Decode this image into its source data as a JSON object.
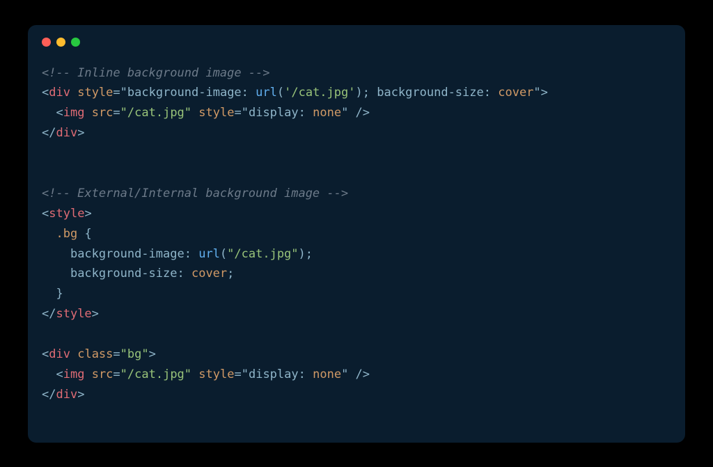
{
  "code": {
    "l1": {
      "comment": "<!-- Inline background image -->"
    },
    "l2": {
      "open": "<",
      "tag": "div",
      "sp": " ",
      "attr": "style",
      "eq": "=",
      "q1": "\"",
      "prop1": "background-image",
      "col1": ": ",
      "func": "url",
      "paren1": "(",
      "url1": "'/cat.jpg'",
      "paren2": ")",
      "semi1": "; ",
      "prop2": "background-size",
      "col2": ": ",
      "val2": "cover",
      "q2": "\"",
      "close": ">"
    },
    "l3": {
      "indent": "  ",
      "open": "<",
      "tag": "img",
      "sp1": " ",
      "attr1": "src",
      "eq1": "=",
      "val1": "\"/cat.jpg\"",
      "sp2": " ",
      "attr2": "style",
      "eq2": "=",
      "q2": "\"",
      "prop": "display",
      "col": ": ",
      "pval": "none",
      "q3": "\"",
      "close": " />"
    },
    "l4": {
      "open": "</",
      "tag": "div",
      "close": ">"
    },
    "l7": {
      "comment": "<!-- External/Internal background image -->"
    },
    "l8": {
      "open": "<",
      "tag": "style",
      "close": ">"
    },
    "l9": {
      "indent": "  ",
      "sel": ".bg",
      "sp": " ",
      "brace": "{"
    },
    "l10": {
      "indent": "    ",
      "prop": "background-image",
      "col": ": ",
      "func": "url",
      "paren1": "(",
      "url": "\"/cat.jpg\"",
      "paren2": ")",
      "semi": ";"
    },
    "l11": {
      "indent": "    ",
      "prop": "background-size",
      "col": ": ",
      "val": "cover",
      "semi": ";"
    },
    "l12": {
      "indent": "  ",
      "brace": "}"
    },
    "l13": {
      "open": "</",
      "tag": "style",
      "close": ">"
    },
    "l15": {
      "open": "<",
      "tag": "div",
      "sp": " ",
      "attr": "class",
      "eq": "=",
      "val": "\"bg\"",
      "close": ">"
    },
    "l16": {
      "indent": "  ",
      "open": "<",
      "tag": "img",
      "sp1": " ",
      "attr1": "src",
      "eq1": "=",
      "val1": "\"/cat.jpg\"",
      "sp2": " ",
      "attr2": "style",
      "eq2": "=",
      "q2": "\"",
      "prop": "display",
      "col": ": ",
      "pval": "none",
      "q3": "\"",
      "close": " />"
    },
    "l17": {
      "open": "</",
      "tag": "div",
      "close": ">"
    }
  }
}
